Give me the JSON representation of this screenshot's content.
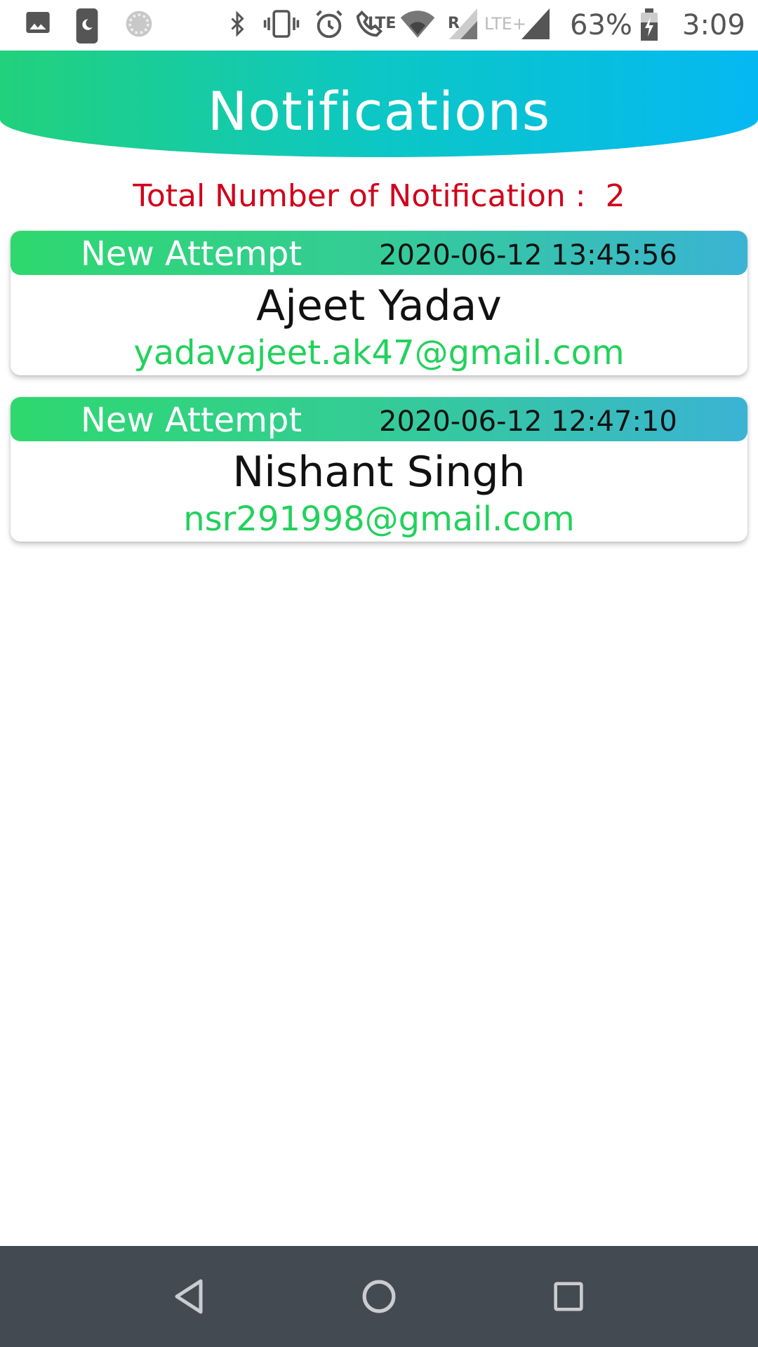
{
  "status_bar": {
    "battery": "63%",
    "time": "3:09",
    "lte_label": "LTE",
    "roaming_label": "R",
    "lte_plus_label": "LTE+"
  },
  "header": {
    "title": "Notifications"
  },
  "summary": {
    "label": "Total Number of Notification :",
    "count": "2"
  },
  "notifications": [
    {
      "type": "New Attempt",
      "time": "2020-06-12 13:45:56",
      "name": "Ajeet Yadav",
      "email": "yadavajeet.ak47@gmail.com"
    },
    {
      "type": "New Attempt",
      "time": "2020-06-12 12:47:10",
      "name": "Nishant Singh",
      "email": "nsr291998@gmail.com"
    }
  ],
  "colors": {
    "header_start": "#22d17c",
    "header_end": "#05b8f2",
    "total_text": "#d0021b",
    "email_text": "#22d15c",
    "nav_bar": "#444a51"
  },
  "icons": {
    "status_left": [
      "image-icon",
      "moon-icon",
      "loading-icon"
    ],
    "status_right": [
      "bluetooth-icon",
      "vibrate-icon",
      "alarm-icon",
      "lte-call-icon",
      "wifi-icon",
      "signal-roaming-icon",
      "signal-lte-plus-icon",
      "battery-charging-icon"
    ],
    "nav": [
      "back-icon",
      "home-icon",
      "recents-icon"
    ]
  }
}
